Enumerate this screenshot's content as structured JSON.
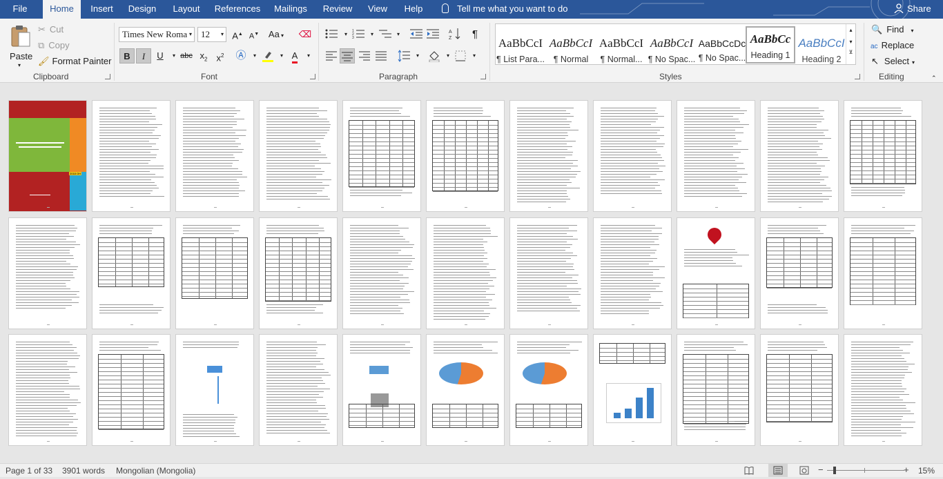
{
  "tabs": [
    {
      "label": "File"
    },
    {
      "label": "Home"
    },
    {
      "label": "Insert"
    },
    {
      "label": "Design"
    },
    {
      "label": "Layout"
    },
    {
      "label": "References"
    },
    {
      "label": "Mailings"
    },
    {
      "label": "Review"
    },
    {
      "label": "View"
    },
    {
      "label": "Help"
    }
  ],
  "tell_me": "Tell me what you want to do",
  "share": "Share",
  "clipboard": {
    "paste": "Paste",
    "cut": "Cut",
    "copy": "Copy",
    "format_painter": "Format Painter",
    "label": "Clipboard"
  },
  "font": {
    "name": "Times New Roma",
    "size": "12",
    "label": "Font",
    "grow": "A",
    "shrink": "A",
    "change_case": "Aa",
    "bold": "B",
    "italic": "I",
    "underline": "U",
    "strike": "abc",
    "sub": "x",
    "sup": "x",
    "sub_mark": "2",
    "sup_mark": "2",
    "font_color_letter": "A"
  },
  "paragraph": {
    "label": "Paragraph"
  },
  "styles": {
    "label": "Styles",
    "items": [
      {
        "preview": "AaBbCcI",
        "name": "¶ List Para..."
      },
      {
        "preview": "AaBbCcI",
        "name": "¶ Normal"
      },
      {
        "preview": "AaBbCcI",
        "name": "¶ Normal..."
      },
      {
        "preview": "AaBbCcI",
        "name": "¶ No Spac..."
      },
      {
        "preview": "AaBbCcDc",
        "name": "¶ No Spac..."
      },
      {
        "preview": "AaBbCc",
        "name": "Heading 1"
      },
      {
        "preview": "AaBbCcI",
        "name": "Heading 2"
      }
    ]
  },
  "editing": {
    "find": "Find",
    "replace": "Replace",
    "select": "Select",
    "label": "Editing"
  },
  "status": {
    "page": "Page 1 of 33",
    "words": "3901 words",
    "language": "Mongolian (Mongolia)",
    "zoom": "15%"
  },
  "colors": {
    "accent": "#2b579a",
    "highlight": "#ffff00",
    "font_color": "#e81123"
  },
  "cover": {
    "year": "2018 ОН"
  }
}
